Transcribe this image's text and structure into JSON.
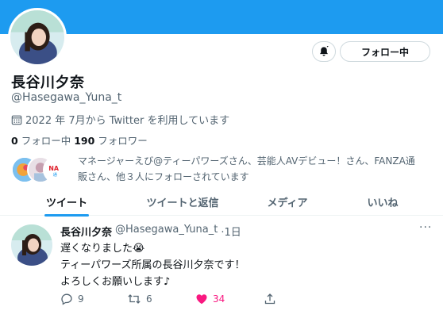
{
  "profile": {
    "name": "長谷川夕奈",
    "handle": "@Hasegawa_Yuna_t",
    "joined": "2022 年 7月から Twitter を利用しています",
    "following_count": "0",
    "following_label": "フォロー中",
    "followers_count": "190",
    "followers_label": "フォロワー",
    "followed_by_line1": "マネージャーえび@ティーパワーズさん、芸能人AVデビュー！さん、FANZA通",
    "followed_by_line2": "販さん、他３人にフォローされています"
  },
  "buttons": {
    "follow_label": "フォロー中",
    "notify_icon": "bell-icon"
  },
  "tabs": [
    {
      "label": "ツイート",
      "active": true
    },
    {
      "label": "ツイートと返信",
      "active": false
    },
    {
      "label": "メディア",
      "active": false
    },
    {
      "label": "いいね",
      "active": false
    }
  ],
  "tweet": {
    "name": "長谷川夕奈",
    "handle": "@Hasegawa_Yuna_t",
    "time": "·1日",
    "more_icon": "···",
    "line1": "遅くなりました😭",
    "line2": "ティーパワーズ所属の長谷川夕奈です！",
    "line3": "よろしくお願いします♪",
    "replies": "9",
    "retweets": "6",
    "likes": "34"
  },
  "colors": {
    "brand_blue": "#1d9bf0",
    "like_pink": "#f91880",
    "secondary_text": "#536471"
  }
}
